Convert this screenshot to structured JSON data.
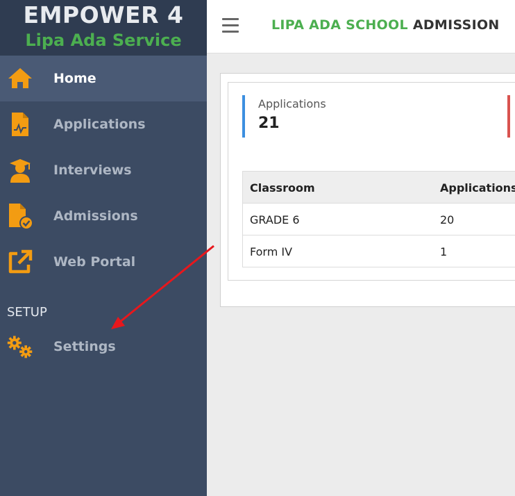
{
  "brand": {
    "title": "EMPOWER 4",
    "subtitle": "Lipa Ada Service"
  },
  "sidebar": {
    "items": [
      {
        "label": "Home",
        "icon": "home-icon",
        "active": true
      },
      {
        "label": "Applications",
        "icon": "document-chart-icon"
      },
      {
        "label": "Interviews",
        "icon": "graduate-icon"
      },
      {
        "label": "Admissions",
        "icon": "file-check-icon"
      },
      {
        "label": "Web Portal",
        "icon": "external-link-icon"
      }
    ],
    "section_label": "SETUP",
    "settings": {
      "label": "Settings",
      "icon": "gears-icon"
    },
    "icon_color": "#f39c12"
  },
  "header": {
    "title_part1": "LIPA ADA SCHOOL",
    "title_part2": "ADMISSION"
  },
  "stats": [
    {
      "label": "Applications",
      "value": "21",
      "accent": "#3c8fe0"
    }
  ],
  "table": {
    "headers": [
      "Classroom",
      "Applications"
    ],
    "rows": [
      [
        "GRADE 6",
        "20"
      ],
      [
        "Form IV",
        "1"
      ]
    ]
  },
  "annotation": {
    "color": "#e8171c"
  }
}
